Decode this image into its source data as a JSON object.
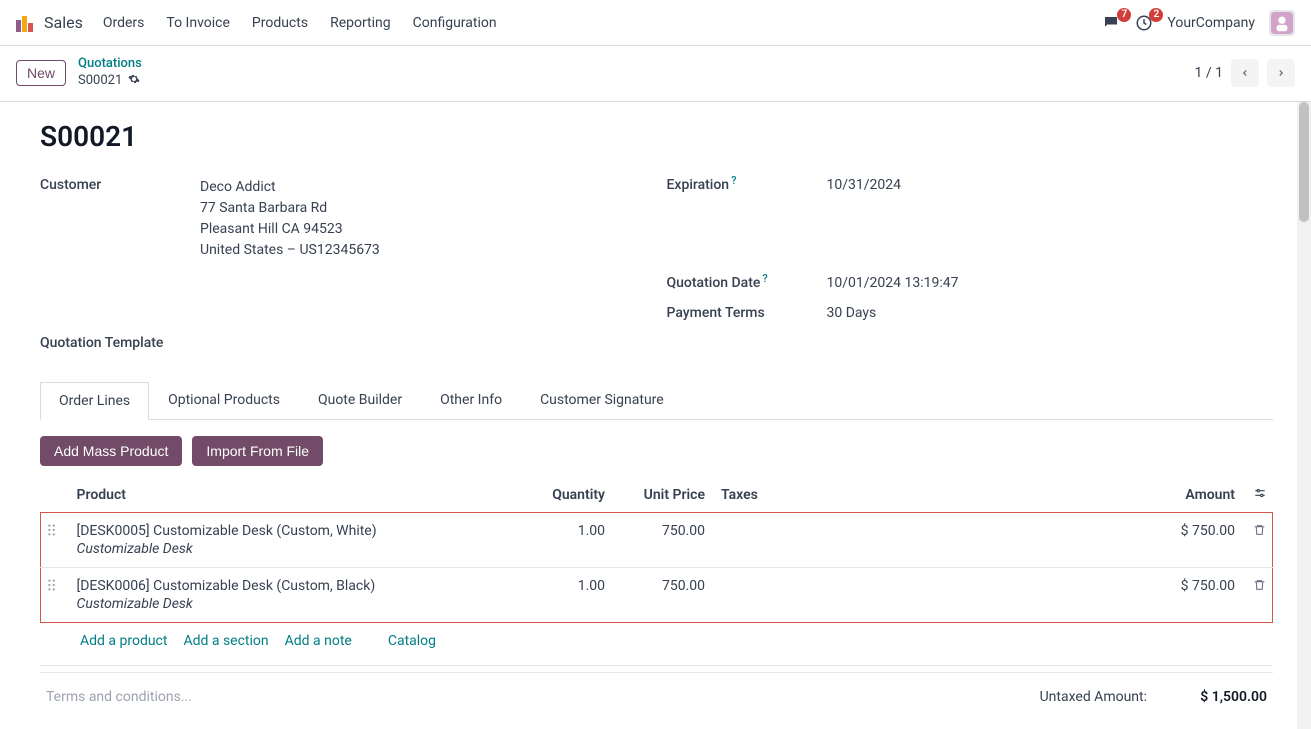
{
  "app": {
    "name": "Sales"
  },
  "nav": {
    "orders": "Orders",
    "to_invoice": "To Invoice",
    "products": "Products",
    "reporting": "Reporting",
    "configuration": "Configuration"
  },
  "topbar": {
    "messages_badge": "7",
    "activities_badge": "2",
    "company": "YourCompany"
  },
  "subheader": {
    "new": "New",
    "breadcrumb_parent": "Quotations",
    "breadcrumb_current": "S00021",
    "pager": "1 / 1"
  },
  "record": {
    "title": "S00021",
    "labels": {
      "customer": "Customer",
      "quotation_template": "Quotation Template",
      "expiration": "Expiration",
      "quotation_date": "Quotation Date",
      "payment_terms": "Payment Terms"
    },
    "customer": {
      "name": "Deco Addict",
      "line1": "77 Santa Barbara Rd",
      "line2": "Pleasant Hill CA 94523",
      "line3": "United States – US12345673"
    },
    "expiration": "10/31/2024",
    "quotation_date": "10/01/2024 13:19:47",
    "payment_terms": "30 Days"
  },
  "tabs": {
    "order_lines": "Order Lines",
    "optional_products": "Optional Products",
    "quote_builder": "Quote Builder",
    "other_info": "Other Info",
    "customer_signature": "Customer Signature"
  },
  "actions": {
    "add_mass_product": "Add Mass Product",
    "import_from_file": "Import From File"
  },
  "columns": {
    "product": "Product",
    "quantity": "Quantity",
    "unit_price": "Unit Price",
    "taxes": "Taxes",
    "amount": "Amount"
  },
  "lines": [
    {
      "product": "[DESK0005] Customizable Desk (Custom, White)",
      "description": "Customizable Desk",
      "quantity": "1.00",
      "unit_price": "750.00",
      "amount": "$ 750.00"
    },
    {
      "product": "[DESK0006] Customizable Desk (Custom, Black)",
      "description": "Customizable Desk",
      "quantity": "1.00",
      "unit_price": "750.00",
      "amount": "$ 750.00"
    }
  ],
  "add_links": {
    "add_product": "Add a product",
    "add_section": "Add a section",
    "add_note": "Add a note",
    "catalog": "Catalog"
  },
  "footer": {
    "terms_placeholder": "Terms and conditions...",
    "untaxed_label": "Untaxed Amount:",
    "untaxed_value": "$ 1,500.00"
  }
}
